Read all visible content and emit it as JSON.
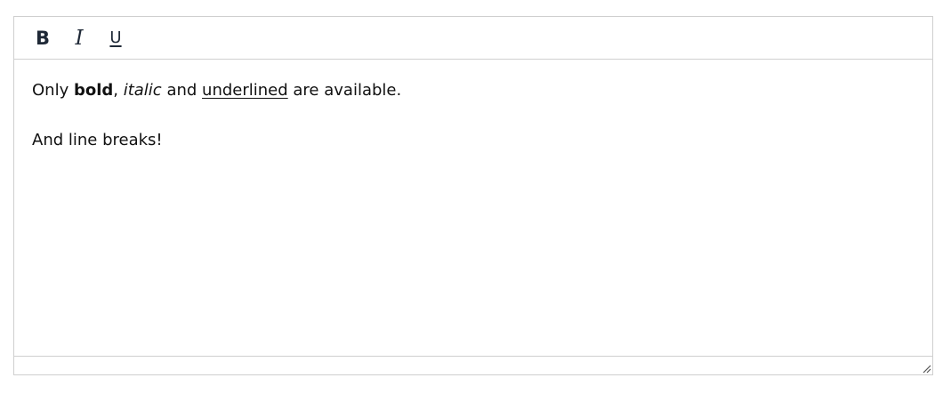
{
  "toolbar": {
    "buttons": [
      {
        "label": "B",
        "icon": "bold-icon"
      },
      {
        "label": "I",
        "icon": "italic-icon"
      },
      {
        "label": "U",
        "icon": "underline-icon"
      }
    ]
  },
  "content": {
    "line1": {
      "prefix": "Only ",
      "bold": "bold",
      "sep": ", ",
      "italic": "italic",
      "mid": " and ",
      "underlined": "underlined",
      "suffix": " are available."
    },
    "line2": "And line breaks!"
  },
  "colors": {
    "border": "#cfcfcf",
    "toolbar_icon": "#1f2937",
    "text": "#111111"
  }
}
